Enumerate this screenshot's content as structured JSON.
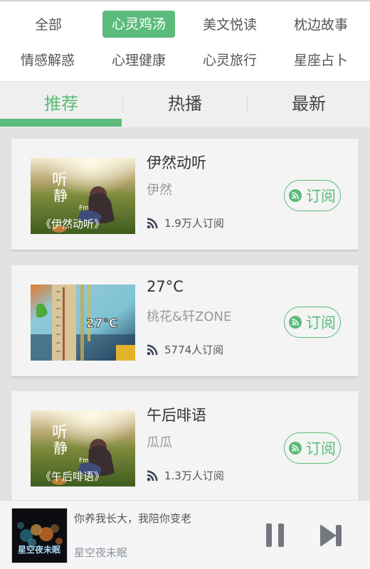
{
  "categories": [
    {
      "label": "全部",
      "active": false
    },
    {
      "label": "心灵鸡汤",
      "active": true
    },
    {
      "label": "美文悦读",
      "active": false
    },
    {
      "label": "枕边故事",
      "active": false
    },
    {
      "label": "情感解惑",
      "active": false
    },
    {
      "label": "心理健康",
      "active": false
    },
    {
      "label": "心灵旅行",
      "active": false
    },
    {
      "label": "星座占卜",
      "active": false
    }
  ],
  "tabs": [
    {
      "label": "推荐",
      "active": true
    },
    {
      "label": "热播",
      "active": false
    },
    {
      "label": "最新",
      "active": false
    }
  ],
  "colors": {
    "accent": "#5bbb7b",
    "text_primary": "#333333",
    "text_secondary": "#999999"
  },
  "channels": [
    {
      "title": "伊然动听",
      "author": "伊然",
      "subscribers": "1.9万人订阅",
      "subscribe_label": "订阅",
      "thumb_icon": "fm-cover-girl-field",
      "thumb_caption": "《伊然动听》",
      "thumb_brand": "听静 Fm"
    },
    {
      "title": "27°C",
      "author": "桃花&轩ZONE",
      "subscribers": "5774人订阅",
      "subscribe_label": "订阅",
      "thumb_icon": "thermometer-cover",
      "thumb_caption": "27℃"
    },
    {
      "title": "午后啡语",
      "author": "瓜瓜",
      "subscribers": "1.3万人订阅",
      "subscribe_label": "订阅",
      "thumb_icon": "fm-cover-girl-field",
      "thumb_caption": "《午后啡语》",
      "thumb_brand": "听静 Fm"
    }
  ],
  "player": {
    "title": "你养我长大，我陪你变老",
    "channel": "星空夜未眠",
    "cover_caption": "星空夜未眠",
    "state": "playing"
  }
}
